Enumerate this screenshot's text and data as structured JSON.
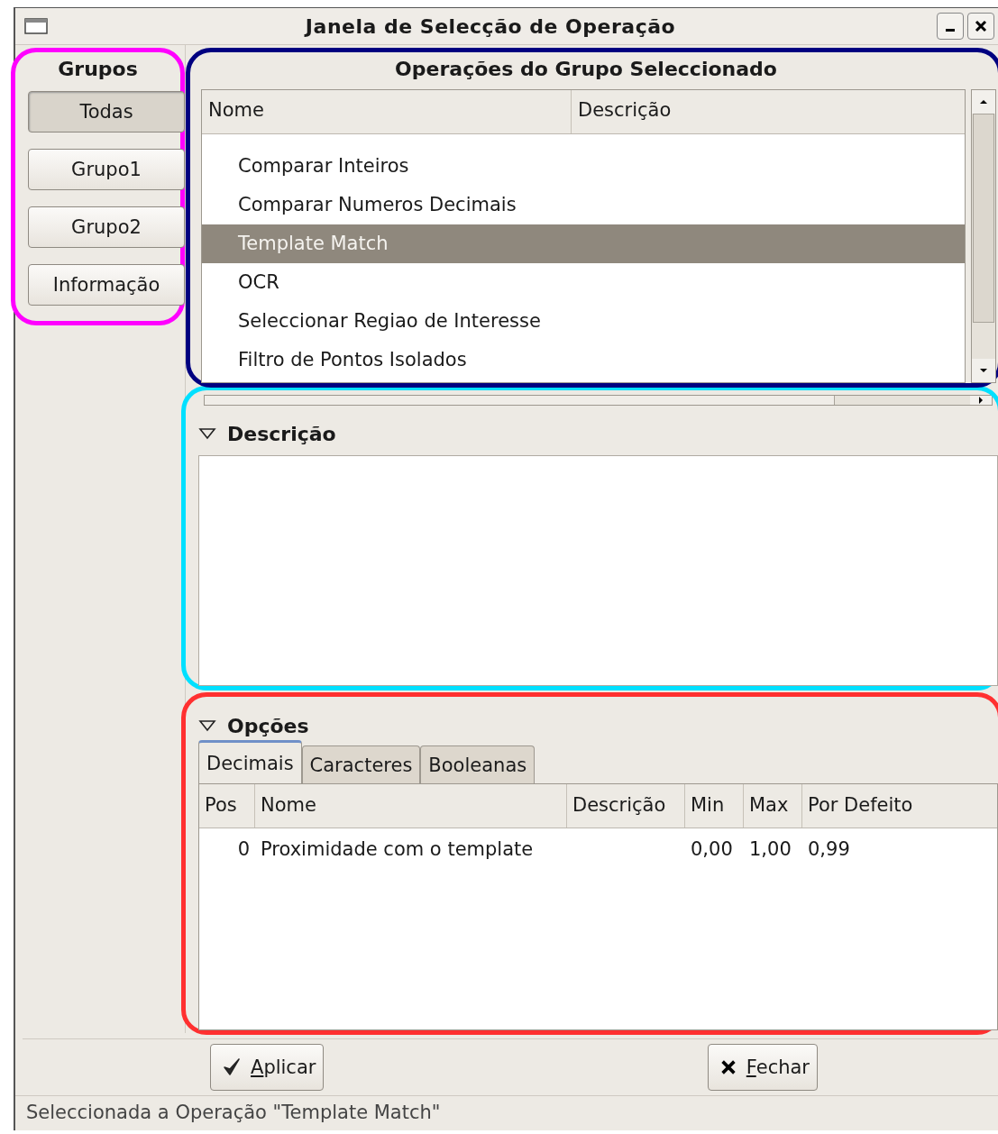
{
  "window": {
    "title": "Janela de Selecção de Operação"
  },
  "groups": {
    "title": "Grupos",
    "items": [
      {
        "label": "Todas",
        "selected": true
      },
      {
        "label": "Grupo1",
        "selected": false
      },
      {
        "label": "Grupo2",
        "selected": false
      },
      {
        "label": "Informação",
        "selected": false
      }
    ]
  },
  "operations": {
    "title": "Operações do Grupo Seleccionado",
    "columns": [
      "Nome",
      "Descrição"
    ],
    "rows": [
      {
        "name": "Comparar Inteiros",
        "selected": false
      },
      {
        "name": "Comparar Numeros Decimais",
        "selected": false
      },
      {
        "name": "Template Match",
        "selected": true
      },
      {
        "name": "OCR",
        "selected": false
      },
      {
        "name": "Seleccionar Regiao de Interesse",
        "selected": false
      },
      {
        "name": "Filtro de Pontos Isolados",
        "selected": false
      }
    ]
  },
  "description": {
    "title": "Descrição",
    "expanded": true
  },
  "options": {
    "title": "Opções",
    "expanded": true,
    "tabs": [
      {
        "label": "Decimais",
        "selected": true
      },
      {
        "label": "Caracteres",
        "selected": false
      },
      {
        "label": "Booleanas",
        "selected": false
      }
    ],
    "columns": [
      "Pos",
      "Nome",
      "Descrição",
      "Min",
      "Max",
      "Por Defeito"
    ],
    "rows": [
      [
        "0",
        "Proximidade com o template",
        "",
        "0,00",
        "1,00",
        "0,99"
      ]
    ]
  },
  "buttons": [
    {
      "kind": "apply",
      "label": "Aplicar"
    },
    {
      "kind": "close",
      "label": "Fechar"
    }
  ],
  "status_bar": "Seleccionada a Operação \"Template Match\""
}
